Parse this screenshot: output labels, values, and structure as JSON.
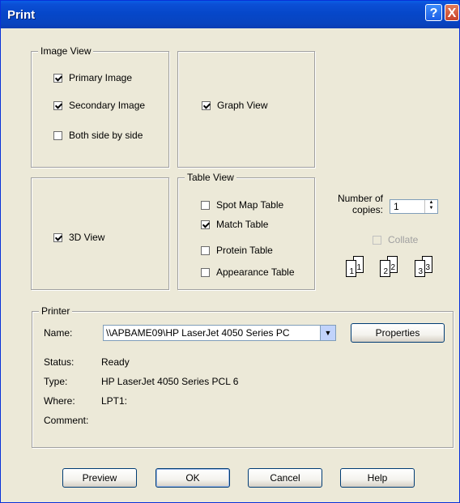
{
  "window": {
    "title": "Print",
    "help_label": "?",
    "close_label": "X"
  },
  "image_view": {
    "legend": "Image View",
    "primary": {
      "label": "Primary Image",
      "checked": true
    },
    "secondary": {
      "label": "Secondary Image",
      "checked": true
    },
    "side_by_side": {
      "label": "Both side by side",
      "checked": false
    }
  },
  "graph_view": {
    "label": "Graph View",
    "checked": true
  },
  "view_3d": {
    "label": "3D View",
    "checked": true
  },
  "table_view": {
    "legend": "Table View",
    "spot_map": {
      "label": "Spot Map Table",
      "checked": false
    },
    "match": {
      "label": "Match Table",
      "checked": true
    },
    "protein": {
      "label": "Protein Table",
      "checked": false
    },
    "appearance": {
      "label": "Appearance Table",
      "checked": false
    }
  },
  "copies": {
    "label_line1": "Number of",
    "label_line2": "copies:",
    "value": "1",
    "collate_label": "Collate",
    "collate_checked": false,
    "pages": [
      "1",
      "1",
      "2",
      "2",
      "3",
      "3"
    ]
  },
  "printer": {
    "legend": "Printer",
    "name_label": "Name:",
    "name_value": "\\\\APBAME09\\HP LaserJet 4050 Series PC",
    "properties_label": "Properties",
    "status_label": "Status:",
    "status_value": "Ready",
    "type_label": "Type:",
    "type_value": "HP LaserJet 4050 Series PCL 6",
    "where_label": "Where:",
    "where_value": "LPT1:",
    "comment_label": "Comment:",
    "comment_value": ""
  },
  "buttons": {
    "preview": "Preview",
    "ok": "OK",
    "cancel": "Cancel",
    "help": "Help"
  }
}
